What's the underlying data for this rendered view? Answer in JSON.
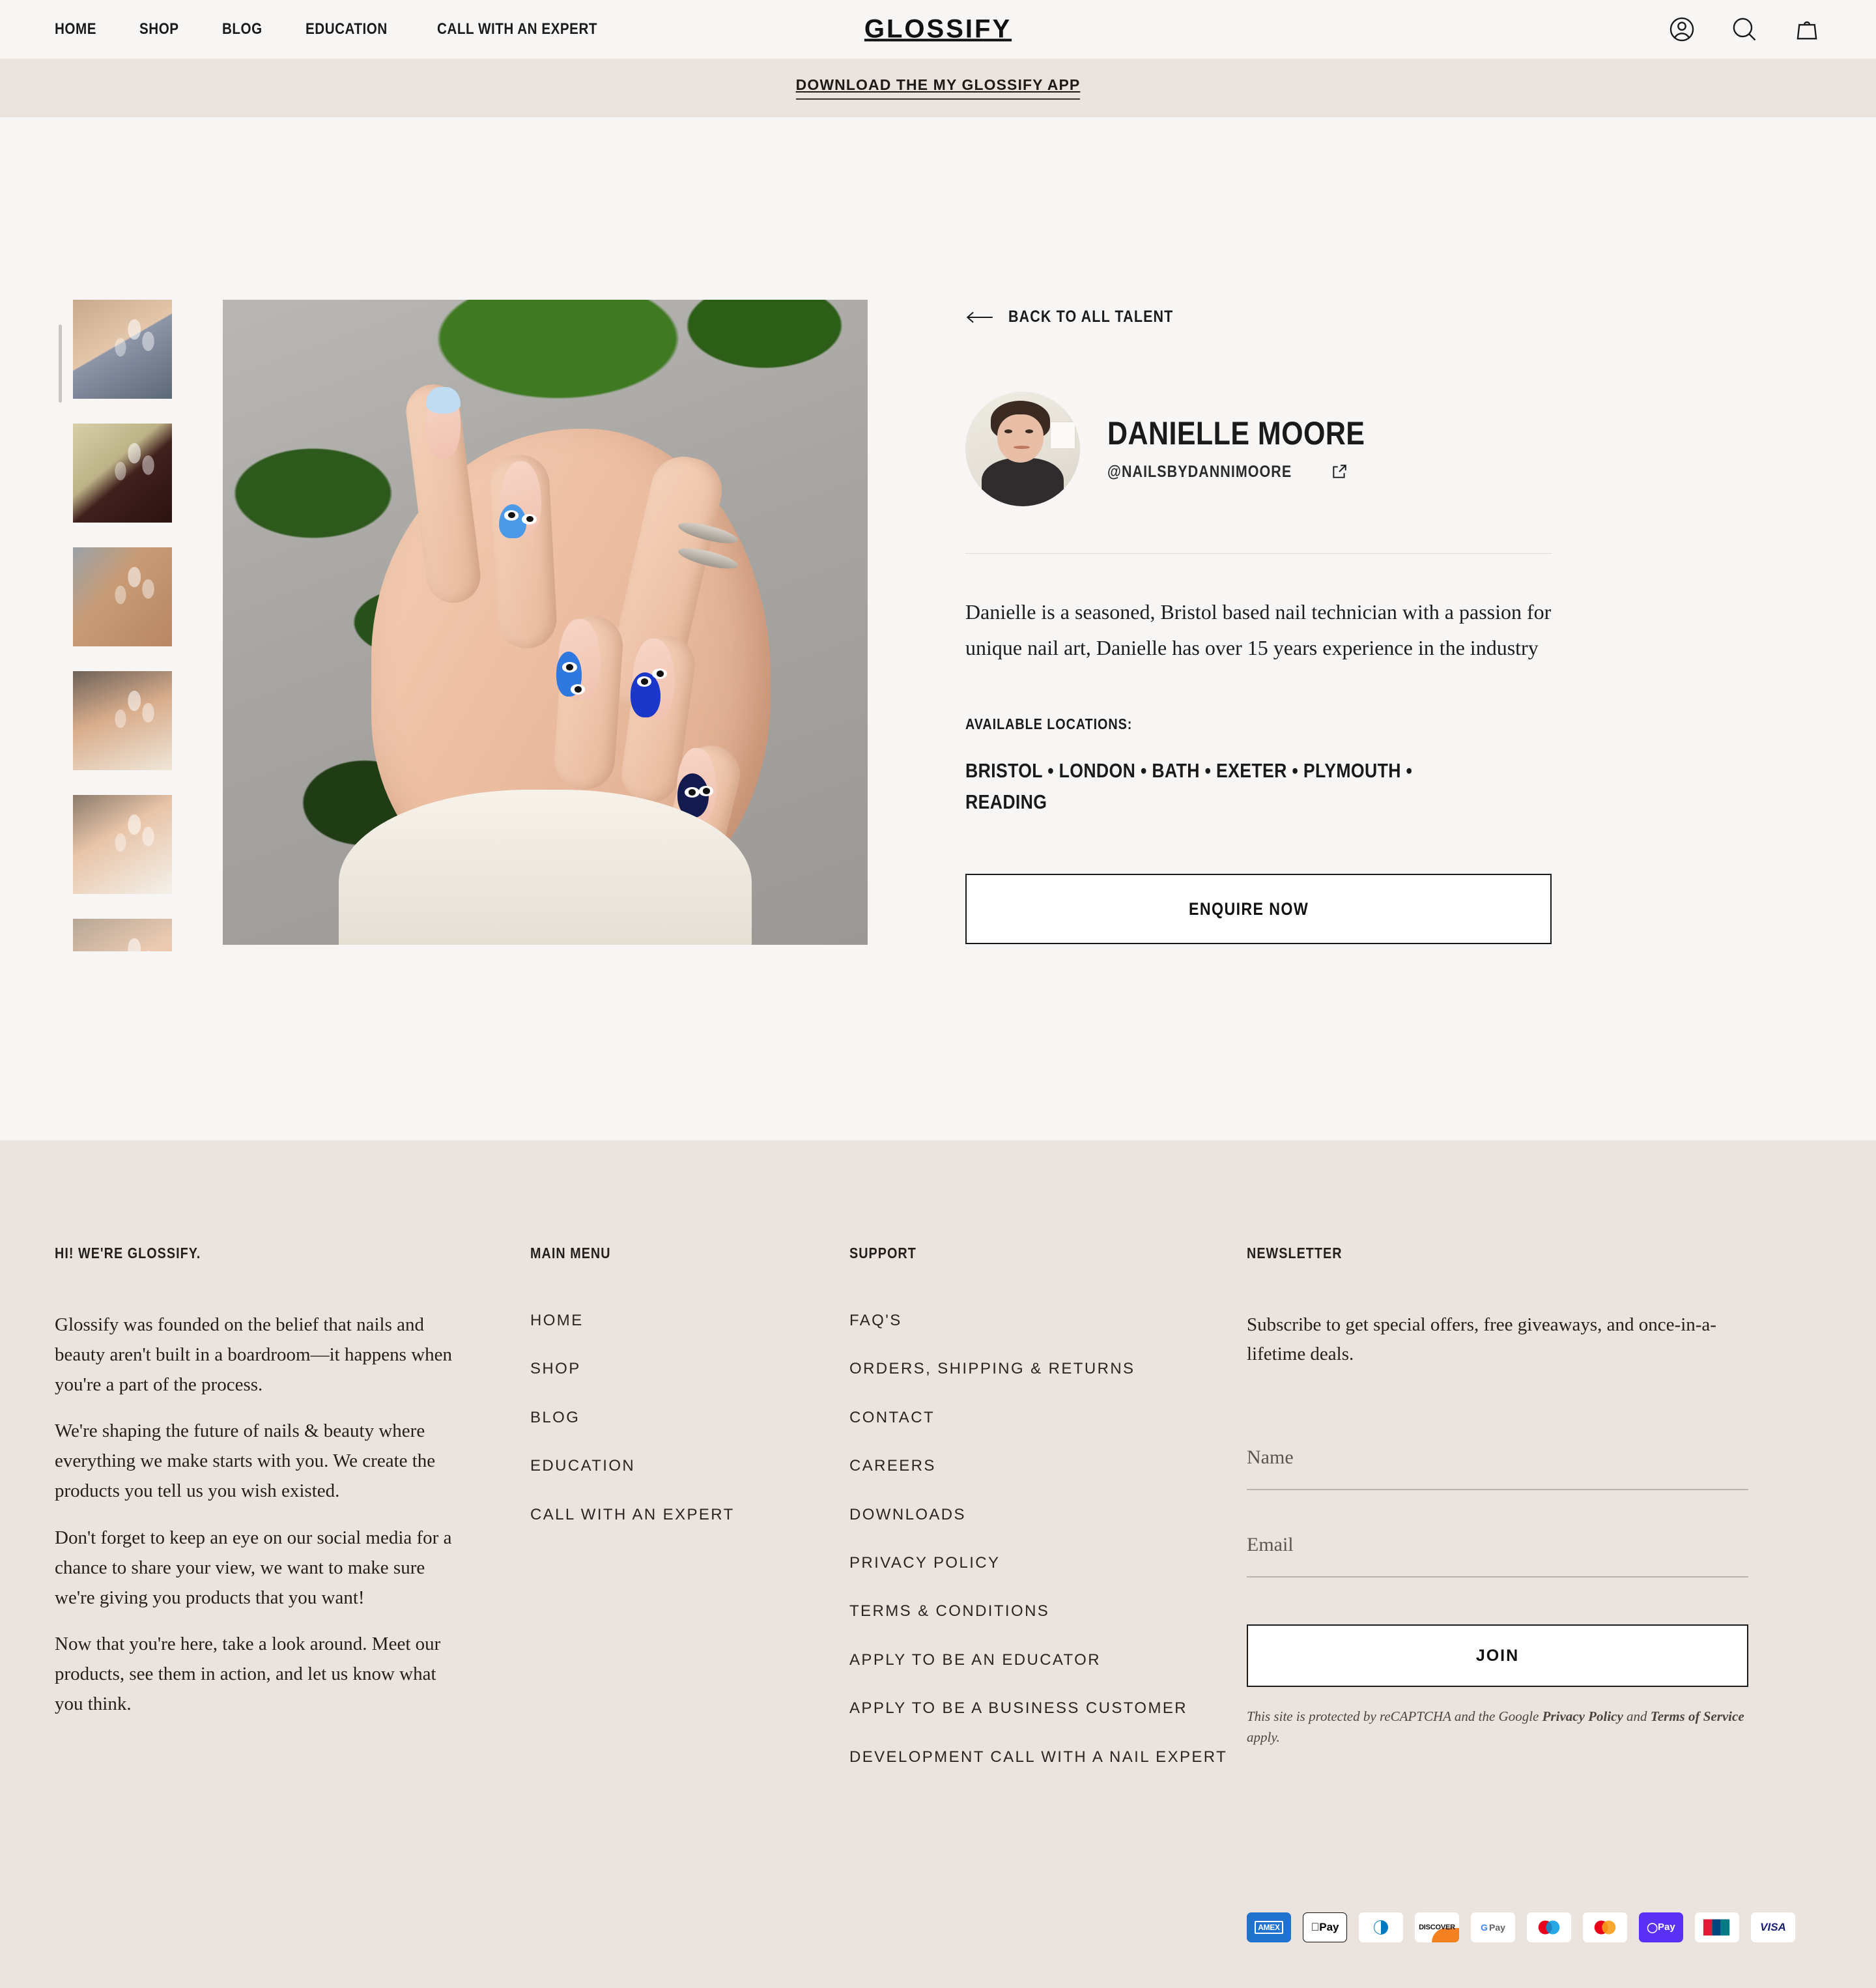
{
  "header": {
    "nav": [
      {
        "label": "HOME"
      },
      {
        "label": "SHOP"
      },
      {
        "label": "BLOG"
      },
      {
        "label": "EDUCATION"
      },
      {
        "label": "CALL WITH AN EXPERT"
      }
    ],
    "brand": "GLOSSIFY",
    "icons": [
      "account-icon",
      "search-icon",
      "cart-icon"
    ]
  },
  "announcement": {
    "text": "DOWNLOAD THE MY GLOSSIFY APP"
  },
  "gallery": {
    "thumbnails": [
      {
        "alt": "Nails with black and white floral art resting on denim"
      },
      {
        "alt": "Dark burgundy glossy nails on snakeskin bag"
      },
      {
        "alt": "Nude nails with small floral accents"
      },
      {
        "alt": "Dark outline french tip nails"
      },
      {
        "alt": "Pink nails with daisy art on polka dot fabric"
      },
      {
        "alt": "Pale pink nails partially visible"
      }
    ],
    "hero": {
      "alt": "Hand with blue evil eye and heart nail art in front of green leaves"
    }
  },
  "talent": {
    "back_link": "BACK TO ALL TALENT",
    "name": "DANIELLE MOORE",
    "handle": "@NAILSBYDANNIMOORE",
    "avatar_alt": "Portrait of Danielle Moore",
    "bio": "Danielle is a seasoned, Bristol based nail technician with a passion for unique nail art, Danielle has over 15 years experience in the industry",
    "locations_label": "AVAILABLE LOCATIONS:",
    "locations": "BRISTOL • LONDON • BATH • EXETER • PLYMOUTH • READING",
    "enquire_label": "ENQUIRE NOW"
  },
  "footer": {
    "about": {
      "heading": "HI! WE'RE GLOSSIFY.",
      "paragraphs": [
        "Glossify was founded on the belief that nails and beauty aren't built in a boardroom—it happens when you're a part of the process.",
        "We're shaping the future of nails & beauty where everything we make starts with you. We create the products you tell us you wish existed.",
        "Don't forget to keep an eye on our social media for a chance to share your view, we want to make sure we're giving you products that you want!",
        "Now that you're here, take a look around. Meet our products, see them in action, and let us know what you think."
      ]
    },
    "main_menu": {
      "heading": "MAIN MENU",
      "links": [
        "HOME",
        "SHOP",
        "BLOG",
        "EDUCATION",
        "CALL WITH AN EXPERT"
      ]
    },
    "support": {
      "heading": "SUPPORT",
      "links": [
        "FAQ'S",
        "ORDERS, SHIPPING & RETURNS",
        "CONTACT",
        "CAREERS",
        "DOWNLOADS",
        "PRIVACY POLICY",
        "TERMS & CONDITIONS",
        "APPLY TO BE AN EDUCATOR",
        "APPLY TO BE A BUSINESS CUSTOMER",
        "DEVELOPMENT CALL WITH A NAIL EXPERT"
      ]
    },
    "newsletter": {
      "heading": "NEWSLETTER",
      "description": "Subscribe to get special offers, free giveaways, and once-in-a-lifetime deals.",
      "name_placeholder": "Name",
      "name_value": "",
      "email_placeholder": "Email",
      "email_value": "",
      "join_label": "JOIN",
      "recaptcha_prefix": "This site is protected by reCAPTCHA and the Google ",
      "recaptcha_privacy": "Privacy Policy",
      "recaptcha_and": " and ",
      "recaptcha_terms": "Terms of Service",
      "recaptcha_suffix": " apply."
    },
    "payments": [
      {
        "name": "amex-icon",
        "label": "AMEX"
      },
      {
        "name": "apple-pay-icon",
        "label": "Pay"
      },
      {
        "name": "diners-club-icon",
        "label": ""
      },
      {
        "name": "discover-icon",
        "label": "DISCOVER"
      },
      {
        "name": "google-pay-icon",
        "label": "Pay"
      },
      {
        "name": "maestro-icon",
        "label": ""
      },
      {
        "name": "mastercard-icon",
        "label": ""
      },
      {
        "name": "shop-pay-icon",
        "label": "Pay"
      },
      {
        "name": "unionpay-icon",
        "label": ""
      },
      {
        "name": "visa-icon",
        "label": "VISA"
      }
    ]
  },
  "colors": {
    "page_bg": "#f7f6f5",
    "footer_bg": "#eae3de",
    "announce_bg": "#eae3de",
    "text": "#1a1a1a"
  }
}
